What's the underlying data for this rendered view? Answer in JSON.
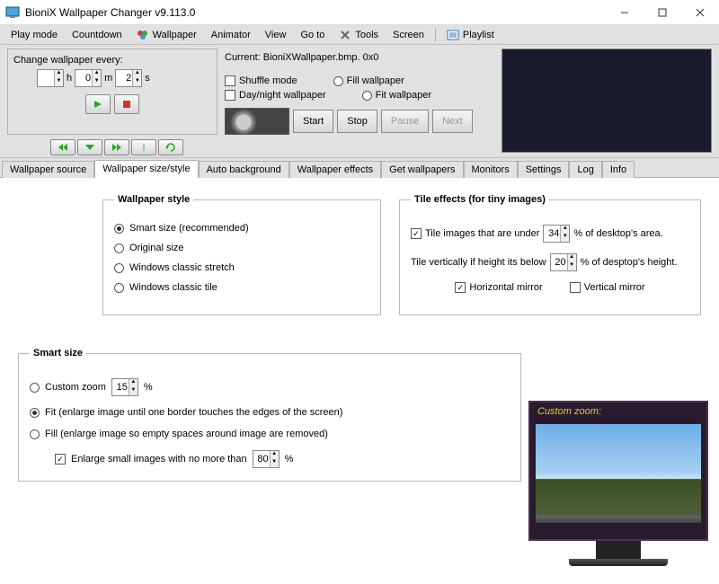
{
  "window": {
    "title": "BioniX Wallpaper Changer v9.113.0"
  },
  "menu": {
    "play_mode": "Play mode",
    "countdown": "Countdown",
    "wallpaper": "Wallpaper",
    "animator": "Animator",
    "view": "View",
    "goto": "Go to",
    "tools": "Tools",
    "screen": "Screen",
    "playlist": "Playlist"
  },
  "interval": {
    "label": "Change wallpaper every:",
    "h_label": "h",
    "m_label": "m",
    "s_label": "s",
    "h_val": "",
    "m_val": "0",
    "s_val": "2"
  },
  "current_label": "Current: BioniXWallpaper.bmp.  0x0",
  "opts": {
    "shuffle": "Shuffle mode",
    "daynight": "Day/night wallpaper",
    "fill": "Fill wallpaper",
    "fit": "Fit wallpaper"
  },
  "actions": {
    "start": "Start",
    "stop": "Stop",
    "pause": "Pause",
    "next": "Next"
  },
  "tabs": {
    "source": "Wallpaper source",
    "size": "Wallpaper size/style",
    "autobg": "Auto background",
    "effects": "Wallpaper effects",
    "get": "Get wallpapers",
    "monitors": "Monitors",
    "settings": "Settings",
    "log": "Log",
    "info": "Info"
  },
  "wstyle": {
    "legend": "Wallpaper style",
    "smart": "Smart size (recommended)",
    "original": "Original size",
    "classic_stretch": "Windows classic stretch",
    "classic_tile": "Windows classic tile"
  },
  "tile": {
    "legend": "Tile effects (for tiny images)",
    "under_a": "Tile images that are under",
    "under_b": "% of desktop's area.",
    "under_val": "34",
    "vert_a": "Tile vertically if height its below",
    "vert_b": "% of desptop's height.",
    "vert_val": "20",
    "hmirror": "Horizontal mirror",
    "vmirror": "Vertical mirror"
  },
  "smart": {
    "legend": "Smart size",
    "custom": "Custom zoom",
    "custom_val": "15",
    "pct": "%",
    "fit": "Fit (enlarge image until one border touches the edges of the screen)",
    "fill": "Fill (enlarge image so empty spaces around image are removed)",
    "enlarge": "Enlarge small images with no more than",
    "enlarge_val": "80"
  },
  "monitor_label": "Custom zoom:"
}
